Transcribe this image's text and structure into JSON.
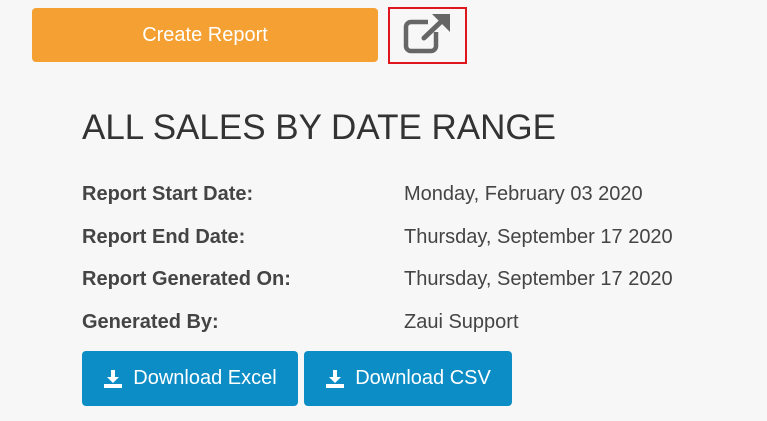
{
  "toolbar": {
    "create_report_label": "Create Report",
    "open_external_icon": "external-link-icon"
  },
  "report": {
    "title": "ALL SALES BY DATE RANGE",
    "fields": [
      {
        "label": "Report Start Date:",
        "value": "Monday, February 03 2020"
      },
      {
        "label": "Report End Date:",
        "value": "Thursday, September 17 2020"
      },
      {
        "label": "Report Generated On:",
        "value": "Thursday, September 17 2020"
      },
      {
        "label": "Generated By:",
        "value": "Zaui Support"
      }
    ]
  },
  "downloads": {
    "excel_label": "Download Excel",
    "csv_label": "Download CSV",
    "icon": "download-icon"
  },
  "colors": {
    "create_button": "#f5a033",
    "download_button": "#0d8dc6",
    "highlight_border": "#e0161e",
    "background": "#f7f7f7"
  }
}
